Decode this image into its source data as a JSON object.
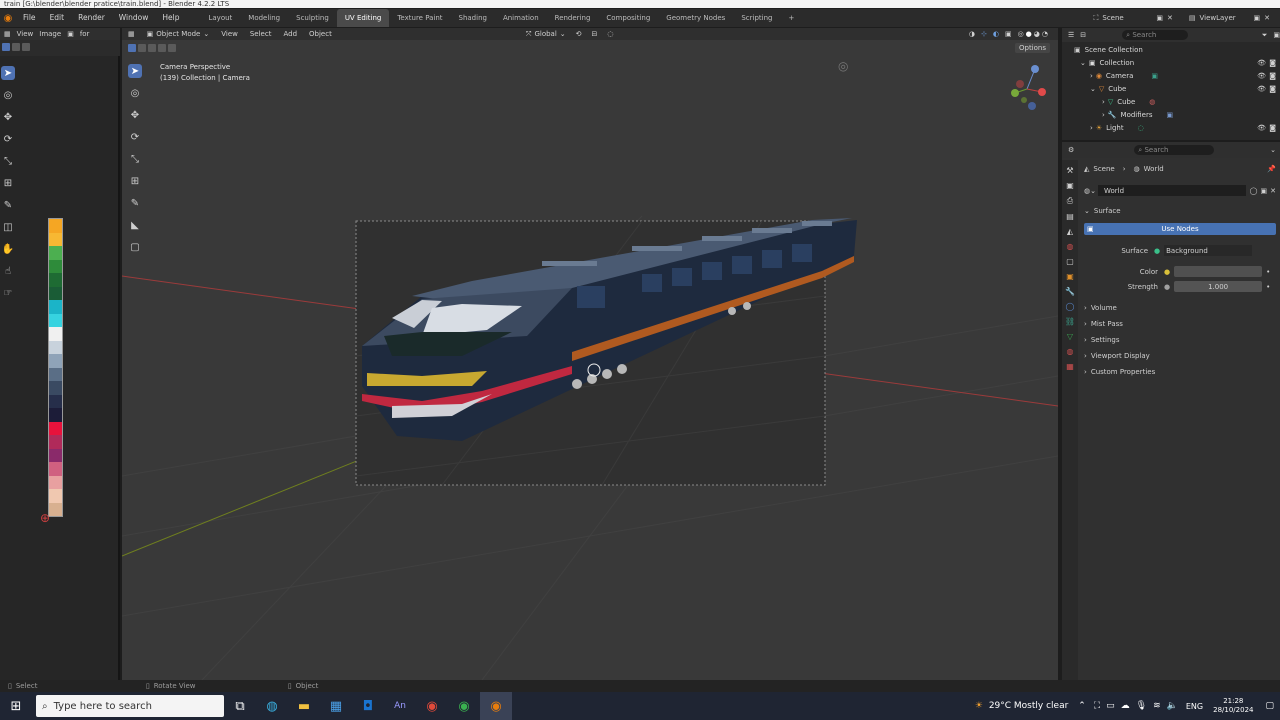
{
  "window_title": "train [G:\\blender\\blender pratice\\train.blend] - Blender 4.2.2 LTS",
  "menu": [
    "File",
    "Edit",
    "Render",
    "Window",
    "Help"
  ],
  "workspaces": [
    "Layout",
    "Modeling",
    "Sculpting",
    "UV Editing",
    "Texture Paint",
    "Shading",
    "Animation",
    "Rendering",
    "Compositing",
    "Geometry Nodes",
    "Scripting"
  ],
  "active_workspace": "UV Editing",
  "scene_label": "Scene",
  "view_layer_label": "ViewLayer",
  "image_editor": {
    "view": "View",
    "image": "Image",
    "slot_partial": "for"
  },
  "viewport": {
    "mode": "Object Mode",
    "menus": [
      "View",
      "Select",
      "Add",
      "Object"
    ],
    "transform_orientation": "Global",
    "options": "Options",
    "overlay_line1": "Camera Perspective",
    "overlay_line2": "(139) Collection | Camera"
  },
  "palette_colors": [
    "#f5a623",
    "#f7b833",
    "#4caf50",
    "#2e8b3a",
    "#1e6b33",
    "#1a5c36",
    "#1bb4c8",
    "#36d3e0",
    "#f0f0f0",
    "#c8d2dc",
    "#8fa3b8",
    "#5a6e86",
    "#3a4a62",
    "#262e4a",
    "#1c1c38",
    "#e8123c",
    "#b02a5a",
    "#8a2a6a",
    "#d06080",
    "#e8a0a0",
    "#f0c8b0",
    "#d8b090"
  ],
  "outliner": {
    "search_placeholder": "Search",
    "root": "Scene Collection",
    "items": [
      {
        "name": "Collection",
        "depth": 0
      },
      {
        "name": "Camera",
        "depth": 1
      },
      {
        "name": "Cube",
        "depth": 1
      },
      {
        "name": "Cube",
        "depth": 2
      },
      {
        "name": "Modifiers",
        "depth": 2
      },
      {
        "name": "Light",
        "depth": 1
      }
    ]
  },
  "properties": {
    "search_placeholder": "Search",
    "breadcrumb": [
      "Scene",
      "World"
    ],
    "world_name": "World",
    "surface_panel": "Surface",
    "use_nodes": "Use Nodes",
    "surface_label": "Surface",
    "surface_value": "Background",
    "color_label": "Color",
    "strength_label": "Strength",
    "strength_value": "1.000",
    "panels": [
      "Volume",
      "Mist Pass",
      "Settings",
      "Viewport Display",
      "Custom Properties"
    ]
  },
  "status": [
    "Select",
    "Rotate View",
    "Object"
  ],
  "taskbar": {
    "search_placeholder": "Type here to search",
    "weather": "29°C  Mostly clear",
    "lang": "ENG",
    "time": "21:28",
    "date": "28/10/2024"
  }
}
